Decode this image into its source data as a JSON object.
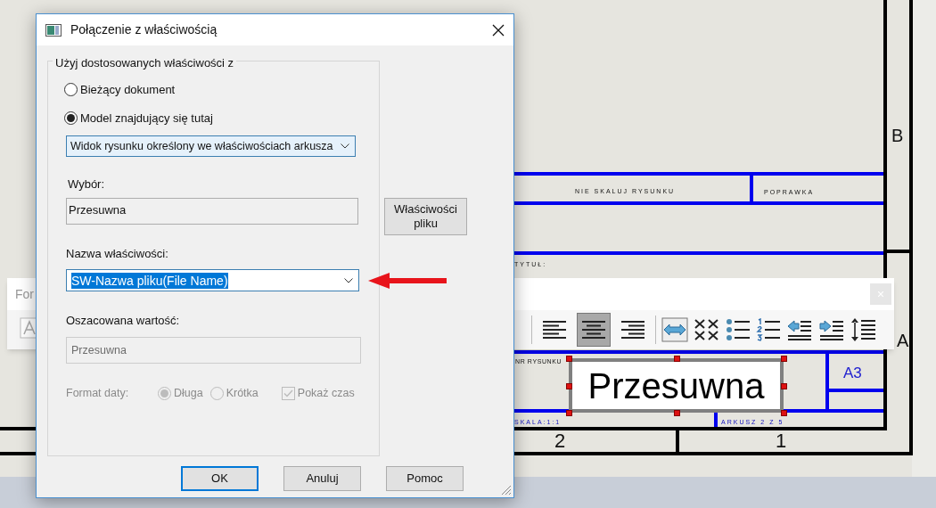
{
  "drawing": {
    "no_scale": "NIE SKALUJ RYSUNKU",
    "revision": "POPRAWKA",
    "title_label": "TYTUŁ:",
    "drawing_number_label": "NR RYSUNKU",
    "scale": "SKALA:1:1",
    "sheet": "ARKUSZ 2 Z 5",
    "sheet_size": "A3",
    "column_numbers": [
      "2",
      "1"
    ],
    "row_letters": [
      "B",
      "A"
    ],
    "text_box": "Przesuwna"
  },
  "format_panel": {
    "label": "For",
    "alignment": [
      {
        "kind": "left",
        "selected": false
      },
      {
        "kind": "center",
        "selected": true
      },
      {
        "kind": "right",
        "selected": false
      }
    ]
  },
  "dialog": {
    "title": "Połączenie z właściwością",
    "group_label": "Użyj dostosowanych właściwości z",
    "sources": [
      {
        "label": "Bieżący dokument",
        "selected": false
      },
      {
        "label": "Model znajdujący się tutaj",
        "selected": true
      }
    ],
    "view_select": "Widok rysunku określony we właściwościach arkusza",
    "selection_label": "Wybór:",
    "selection_value": "Przesuwna",
    "file_properties_button": "Właściwości pliku",
    "property_name_label": "Nazwa właściwości:",
    "property_name_value": "SW-Nazwa pliku(File Name)",
    "estimated_label": "Oszacowana wartość:",
    "estimated_value": "Przesuwna",
    "date_format": {
      "label": "Format daty:",
      "disabled": true,
      "options": [
        {
          "label": "Długa",
          "selected": true
        },
        {
          "label": "Krótka",
          "selected": false
        }
      ],
      "show_time": {
        "label": "Pokaż czas",
        "checked": true
      }
    },
    "buttons": [
      {
        "label": "OK",
        "default": true
      },
      {
        "label": "Anuluj",
        "default": false
      },
      {
        "label": "Pomoc",
        "default": false
      }
    ]
  }
}
